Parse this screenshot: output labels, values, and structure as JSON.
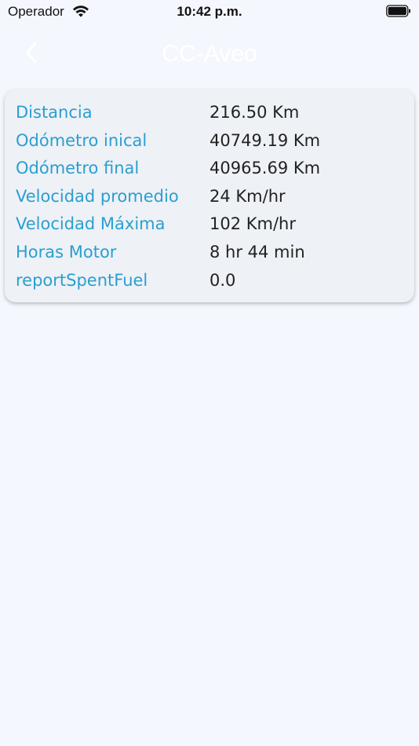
{
  "status_bar": {
    "carrier": "Operador",
    "time": "10:42 p.m."
  },
  "nav": {
    "title": "CC-Aveo"
  },
  "colors": {
    "background": "#f4f7fd",
    "card": "#eef1f6",
    "label": "#2a9fd0",
    "value": "#222222",
    "title": "#ffffff"
  },
  "report": {
    "rows": [
      {
        "label": "Distancia",
        "value": "216.50 Km"
      },
      {
        "label": "Odómetro inical",
        "value": "40749.19 Km"
      },
      {
        "label": "Odómetro final",
        "value": "40965.69 Km"
      },
      {
        "label": "Velocidad promedio",
        "value": "24 Km/hr"
      },
      {
        "label": "Velocidad Máxima",
        "value": "102 Km/hr"
      },
      {
        "label": "Horas Motor",
        "value": "8 hr 44 min"
      },
      {
        "label": "reportSpentFuel",
        "value": "0.0"
      }
    ]
  }
}
